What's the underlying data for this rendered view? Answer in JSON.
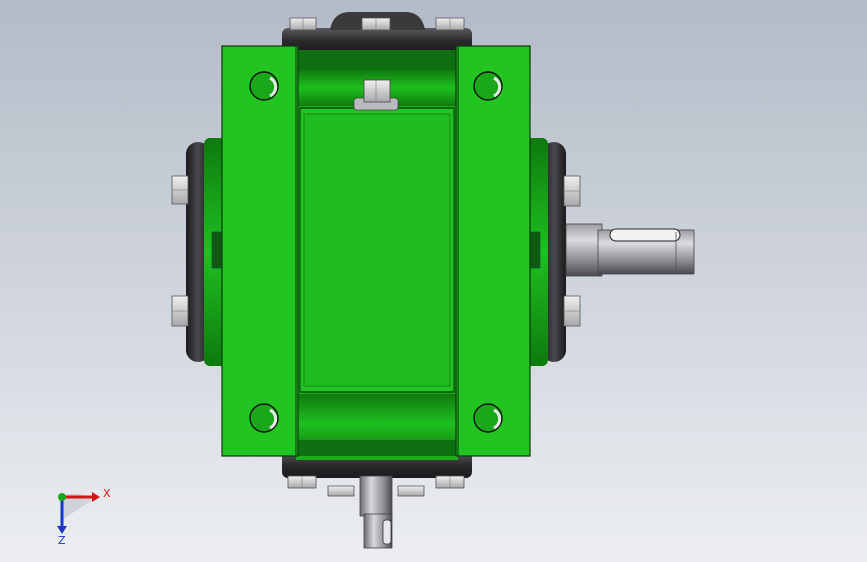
{
  "colors": {
    "background_top": "#b4bcc8",
    "background_bottom": "#e8ebef",
    "green_light": "#22c422",
    "green_main": "#1aa81a",
    "green_dark": "#0d6e0d",
    "gray_dark": "#2e2e30",
    "gray_mid": "#6a6a6c",
    "gray_light": "#c8c8cc",
    "axis_x": "#d01818",
    "axis_y": "#18a818",
    "axis_z": "#1838c8"
  },
  "triad": {
    "x_label": "X",
    "z_label": "Z"
  }
}
